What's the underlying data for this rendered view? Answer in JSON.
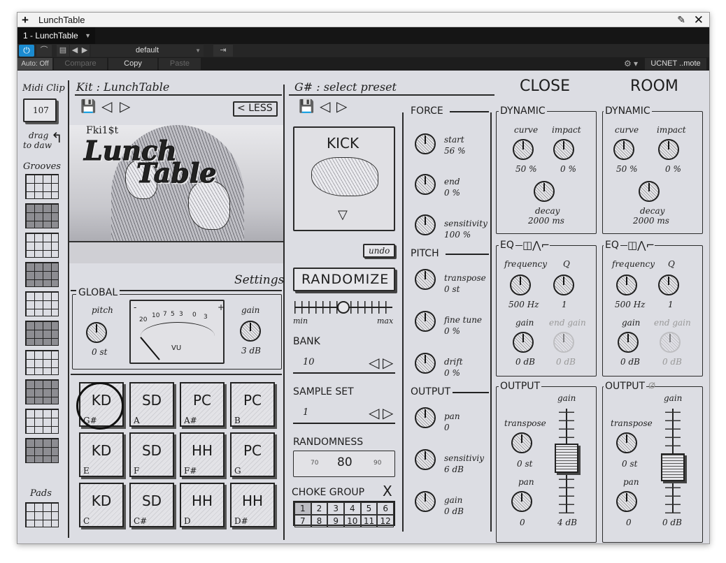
{
  "window": {
    "title": "LunchTable",
    "tab": "1 - LunchTable",
    "preset": "default",
    "auto": "Auto: Off",
    "compare": "Compare",
    "copy": "Copy",
    "paste": "Paste",
    "remote": "UCNET ..mote"
  },
  "left": {
    "midiclip": "Midi Clip",
    "midi_value": "107",
    "drag": "drag",
    "drag2": "to daw",
    "grooves": "Grooves",
    "pads": "Pads"
  },
  "kit": {
    "title": "Kit : LunchTable",
    "less": "LESS",
    "brand_small": "Fki1$t",
    "brand_line1": "Lunch",
    "brand_line2": "Table",
    "settings": "Settings",
    "global": "GLOBAL",
    "pitch_label": "pitch",
    "pitch_value": "0 st",
    "gain_label": "gain",
    "gain_value": "3 dB",
    "vu_scale": [
      "20",
      "10",
      "7",
      "5",
      "3",
      "0",
      "3",
      "+"
    ],
    "vu_minus": "-",
    "vu_label": "VU",
    "pads": [
      {
        "name": "KD",
        "note": "G#"
      },
      {
        "name": "SD",
        "note": "A"
      },
      {
        "name": "PC",
        "note": "A#"
      },
      {
        "name": "PC",
        "note": "B"
      },
      {
        "name": "KD",
        "note": "E"
      },
      {
        "name": "SD",
        "note": "F"
      },
      {
        "name": "HH",
        "note": "F#"
      },
      {
        "name": "PC",
        "note": "G"
      },
      {
        "name": "KD",
        "note": "C"
      },
      {
        "name": "SD",
        "note": "C#"
      },
      {
        "name": "HH",
        "note": "D"
      },
      {
        "name": "HH",
        "note": "D#"
      }
    ]
  },
  "preset": {
    "title": "G# : select preset",
    "sample": "KICK",
    "undo": "undo",
    "randomize": "RANDOMIZE",
    "min": "min",
    "max": "max",
    "random_level": 0.5,
    "bank_label": "BANK",
    "bank_value": "10",
    "sampleset_label": "SAMPLE SET",
    "sampleset_value": "1",
    "randomness_label": "RANDOMNESS",
    "randomness_ticks": [
      "70",
      "80",
      "90"
    ],
    "choke_label": "CHOKE GROUP",
    "choke_x": "X",
    "choke": [
      "1",
      "2",
      "3",
      "4",
      "5",
      "6",
      "7",
      "8",
      "9",
      "10",
      "11",
      "12"
    ]
  },
  "force": {
    "title": "FORCE",
    "start_label": "start",
    "start_value": "56 %",
    "end_label": "end",
    "end_value": "0 %",
    "sens_label": "sensitivity",
    "sens_value": "100 %"
  },
  "pitch": {
    "title": "PITCH",
    "transpose_label": "transpose",
    "transpose_value": "0 st",
    "fine_label": "fine tune",
    "fine_value": "0 %",
    "drift_label": "drift",
    "drift_value": "0 %"
  },
  "output": {
    "title": "OUTPUT",
    "pan_label": "pan",
    "pan_value": "0",
    "sens_label": "sensitiviy",
    "sens_value": "6 dB",
    "gain_label": "gain",
    "gain_value": "0 dB"
  },
  "close": {
    "title": "CLOSE",
    "dyn": "DYNAMIC",
    "curve": "curve",
    "curve_value": "50 %",
    "impact": "impact",
    "impact_value": "0 %",
    "decay": "decay",
    "decay_value": "2000 ms",
    "eq": "EQ",
    "frequency": "frequency",
    "freq_value": "500 Hz",
    "q": "Q",
    "q_value": "1",
    "gain": "gain",
    "gain_value": "0 dB",
    "end_gain": "end gain",
    "end_gain_value": "0 dB",
    "out": "OUTPUT",
    "out_gain": "gain",
    "transpose": "transpose",
    "transpose_value": "0 st",
    "pan": "pan",
    "pan_value": "0",
    "fader_value": "4 dB"
  },
  "room": {
    "title": "ROOM",
    "dyn": "DYNAMIC",
    "curve": "curve",
    "curve_value": "50 %",
    "impact": "impact",
    "impact_value": "0 %",
    "decay": "decay",
    "decay_value": "2000 ms",
    "eq": "EQ",
    "frequency": "frequency",
    "freq_value": "500 Hz",
    "q": "Q",
    "q_value": "1",
    "gain": "gain",
    "gain_value": "0 dB",
    "end_gain": "end gain",
    "end_gain_value": "0 dB",
    "out": "OUTPUT",
    "out_gain": "gain",
    "transpose": "transpose",
    "transpose_value": "0 st",
    "pan": "pan",
    "pan_value": "0",
    "fader_value": "0 dB"
  }
}
